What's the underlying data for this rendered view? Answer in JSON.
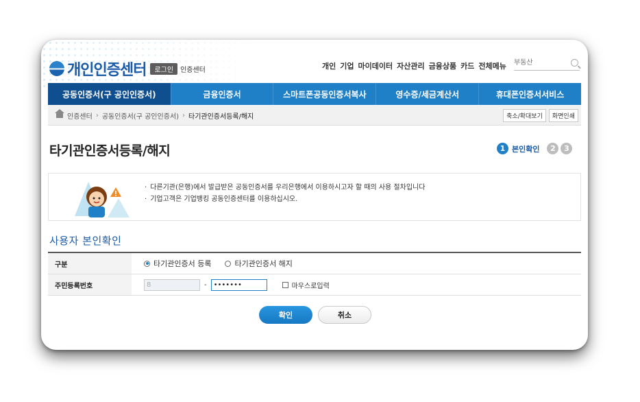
{
  "header": {
    "logo_text": "개인인증센터",
    "login_label": "로그인",
    "sub_label": "인증센터",
    "top_nav": [
      "개인",
      "기업",
      "마이데이터",
      "자산관리",
      "금융상품",
      "카드",
      "전체메뉴"
    ],
    "search_placeholder": "부동산"
  },
  "gnb": {
    "items": [
      "공동인증서(구 공인인증서)",
      "금융인증서",
      "스마트폰공동인증서복사",
      "영수증/세금계산서",
      "휴대폰인증서서비스"
    ],
    "active_index": 0
  },
  "breadcrumb": {
    "items": [
      "인증센터",
      "공동인증서(구 공인인증서)",
      "타기관인증서등록/해지"
    ],
    "tools": [
      "축소/확대보기",
      "화면인쇄"
    ]
  },
  "page": {
    "title": "타기관인증서등록/해지",
    "steps": {
      "s1": "1",
      "s1_label": "본인확인",
      "s2": "2",
      "s3": "3"
    }
  },
  "info": {
    "lines": [
      "다른기관(은행)에서 발급받은 공동인증서를 우리은행에서 이용하시고자 할 때의 사용 절차입니다",
      "기업고객은 기업뱅킹 공동인증센터를 이용하십시오."
    ]
  },
  "section": {
    "heading": "사용자 본인확인",
    "row1_label": "구분",
    "opt_register": "타기관인증서 등록",
    "opt_cancel": "타기관인증서 해지",
    "row2_label": "주민등록번호",
    "rrn_front": "8",
    "rrn_dash": "-",
    "rrn_back": "•••••••",
    "mouse_input_label": "마우스로입력"
  },
  "buttons": {
    "confirm": "확인",
    "cancel": "취소"
  },
  "colors": {
    "brand": "#1b5aa6",
    "gnb": "#1f80c8",
    "gnb_active": "#0f4e8f"
  }
}
